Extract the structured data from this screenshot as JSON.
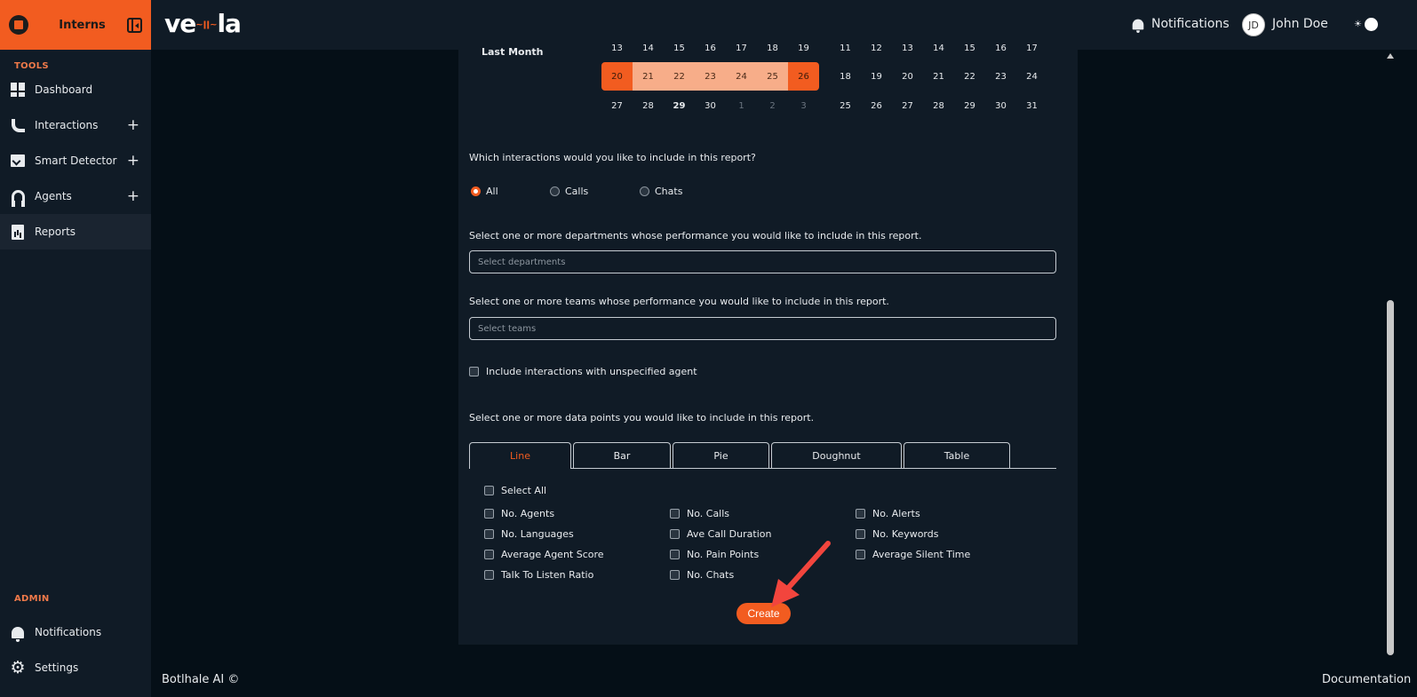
{
  "sidebar": {
    "org_name": "Interns",
    "tools_heading": "TOOLS",
    "admin_heading": "ADMIN",
    "items": [
      {
        "label": "Dashboard",
        "icon": "dashboard-icon",
        "expandable": false
      },
      {
        "label": "Interactions",
        "icon": "phone-icon",
        "expandable": true
      },
      {
        "label": "Smart Detector",
        "icon": "chart-check-icon",
        "expandable": true
      },
      {
        "label": "Agents",
        "icon": "headset-icon",
        "expandable": true
      },
      {
        "label": "Reports",
        "icon": "report-icon",
        "expandable": false,
        "active": true
      }
    ],
    "admin_items": [
      {
        "label": "Notifications",
        "icon": "bell-icon"
      },
      {
        "label": "Settings",
        "icon": "gear-icon"
      }
    ],
    "plus_symbol": "+"
  },
  "header": {
    "logo_text_left": "ve",
    "logo_wave": "~ǀǀ~",
    "logo_text_right": "la",
    "notifications_label": "Notifications",
    "user_initials": "JD",
    "user_name": "John Doe",
    "theme_icon": "☀"
  },
  "calendar": {
    "range_label": "Last Month",
    "left_month": {
      "top_row": [
        "13",
        "14",
        "15",
        "16",
        "17",
        "18",
        "19"
      ],
      "mid_row": [
        "20",
        "21",
        "22",
        "23",
        "24",
        "25",
        "26"
      ],
      "bottom_row": [
        "27",
        "28",
        "29",
        "30",
        "1",
        "2",
        "3"
      ]
    },
    "right_month": {
      "top_row": [
        "11",
        "12",
        "13",
        "14",
        "15",
        "16",
        "17"
      ],
      "mid_row": [
        "18",
        "19",
        "20",
        "21",
        "22",
        "23",
        "24"
      ],
      "bottom_row": [
        "25",
        "26",
        "27",
        "28",
        "29",
        "30",
        "31"
      ]
    }
  },
  "form": {
    "interactions_question": "Which interactions would you like to include in this report?",
    "interaction_options": [
      "All",
      "Calls",
      "Chats"
    ],
    "interaction_selected": "All",
    "departments_question": "Select one or more departments whose performance you would like to include in this report.",
    "departments_placeholder": "Select departments",
    "teams_question": "Select one or more teams whose performance you would like to include in this report.",
    "teams_placeholder": "Select teams",
    "unspecified_agent_label": "Include interactions with unspecified agent",
    "datapoints_question": "Select one or more data points you would like to include in this report.",
    "chart_tabs": [
      "Line",
      "Bar",
      "Pie",
      "Doughnut",
      "Table"
    ],
    "active_tab": "Line",
    "select_all_label": "Select All",
    "datapoints_col1": [
      "No. Agents",
      "No. Languages",
      "Average Agent Score",
      "Talk To Listen Ratio"
    ],
    "datapoints_col2": [
      "No. Calls",
      "Ave Call Duration",
      "No. Pain Points",
      "No. Chats"
    ],
    "datapoints_col3": [
      "No. Alerts",
      "No. Keywords",
      "Average Silent Time"
    ],
    "create_label": "Create"
  },
  "footer": {
    "left": "Botlhale AI ©",
    "right": "Documentation"
  },
  "colors": {
    "accent": "#f25c20",
    "range_fill": "#f7ad89",
    "panel": "#101b26",
    "background": "#050f17",
    "annotation_arrow": "#f2453d"
  }
}
